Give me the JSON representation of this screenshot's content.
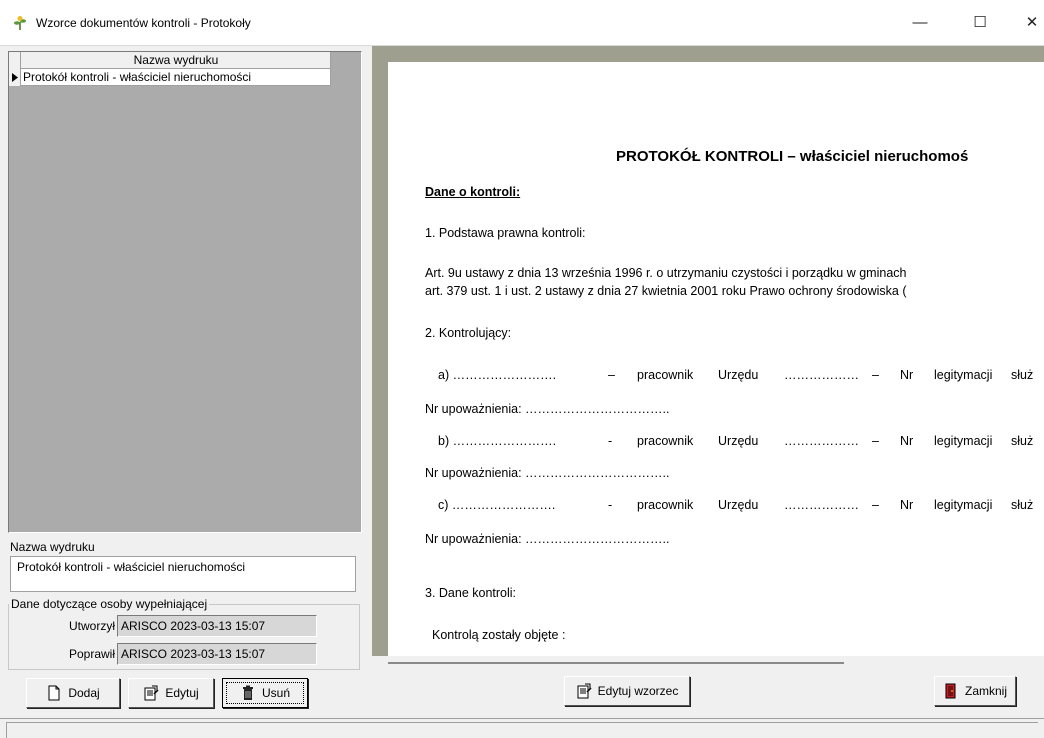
{
  "window": {
    "title": "Wzorce dokumentów kontroli - Protokoły",
    "min_glyph": "—",
    "max_glyph": "☐",
    "close_glyph": "✕",
    "app_icon": "plant-icon"
  },
  "list": {
    "column_header": "Nazwa wydruku",
    "rows": [
      "Protokół kontroli - właściciel nieruchomości"
    ]
  },
  "details": {
    "name_label": "Nazwa wydruku",
    "name_value": "Protokół kontroli - właściciel nieruchomości",
    "group_label": "Dane dotyczące osoby wypełniającej",
    "created_label": "Utworzył",
    "created_value": "ARISCO 2023-03-13 15:07",
    "modified_label": "Poprawił",
    "modified_value": "ARISCO 2023-03-13 15:07"
  },
  "buttons": {
    "add": "Dodaj",
    "edit": "Edytuj",
    "delete": "Usuń",
    "edit_template": "Edytuj wzorzec",
    "close": "Zamknij"
  },
  "document": {
    "title": "PROTOKÓŁ KONTROLI – właściciel nieruchomoś",
    "section_heading": "Dane o kontroli:",
    "item1": "1. Podstawa prawna kontroli:",
    "legal1": "Art. 9u ustawy z dnia 13 września 1996 r. o utrzymaniu czystości i porządku w gminach",
    "legal2": "art. 379 ust. 1 i ust. 2  ustawy z dnia 27 kwietnia 2001 roku Prawo ochrony środowiska (",
    "item2": "2. Kontrolujący:",
    "row_a": {
      "prefix": "a) …………………….",
      "dash": "–",
      "employee": "pracownik",
      "office": "Urzędu",
      "dots": "………………",
      "dash2": "–",
      "nr": "Nr",
      "legit": "legitymacji",
      "sluz": "służ"
    },
    "row_b": {
      "prefix": "b) …………………….",
      "dash": "-",
      "employee": "pracownik",
      "office": "Urzędu",
      "dots": "………………",
      "dash2": "–",
      "nr": "Nr",
      "legit": "legitymacji",
      "sluz": "służ"
    },
    "row_c": {
      "prefix": "c) …………………….",
      "dash": "-",
      "employee": "pracownik",
      "office": "Urzędu",
      "dots": "………………",
      "dash2": "–",
      "nr": "Nr",
      "legit": "legitymacji",
      "sluz": "służ"
    },
    "auth_line": "Nr upoważnienia: ……………………………..",
    "item3": "3. Dane kontroli:",
    "covered": "Kontrolą zostały objęte :"
  }
}
